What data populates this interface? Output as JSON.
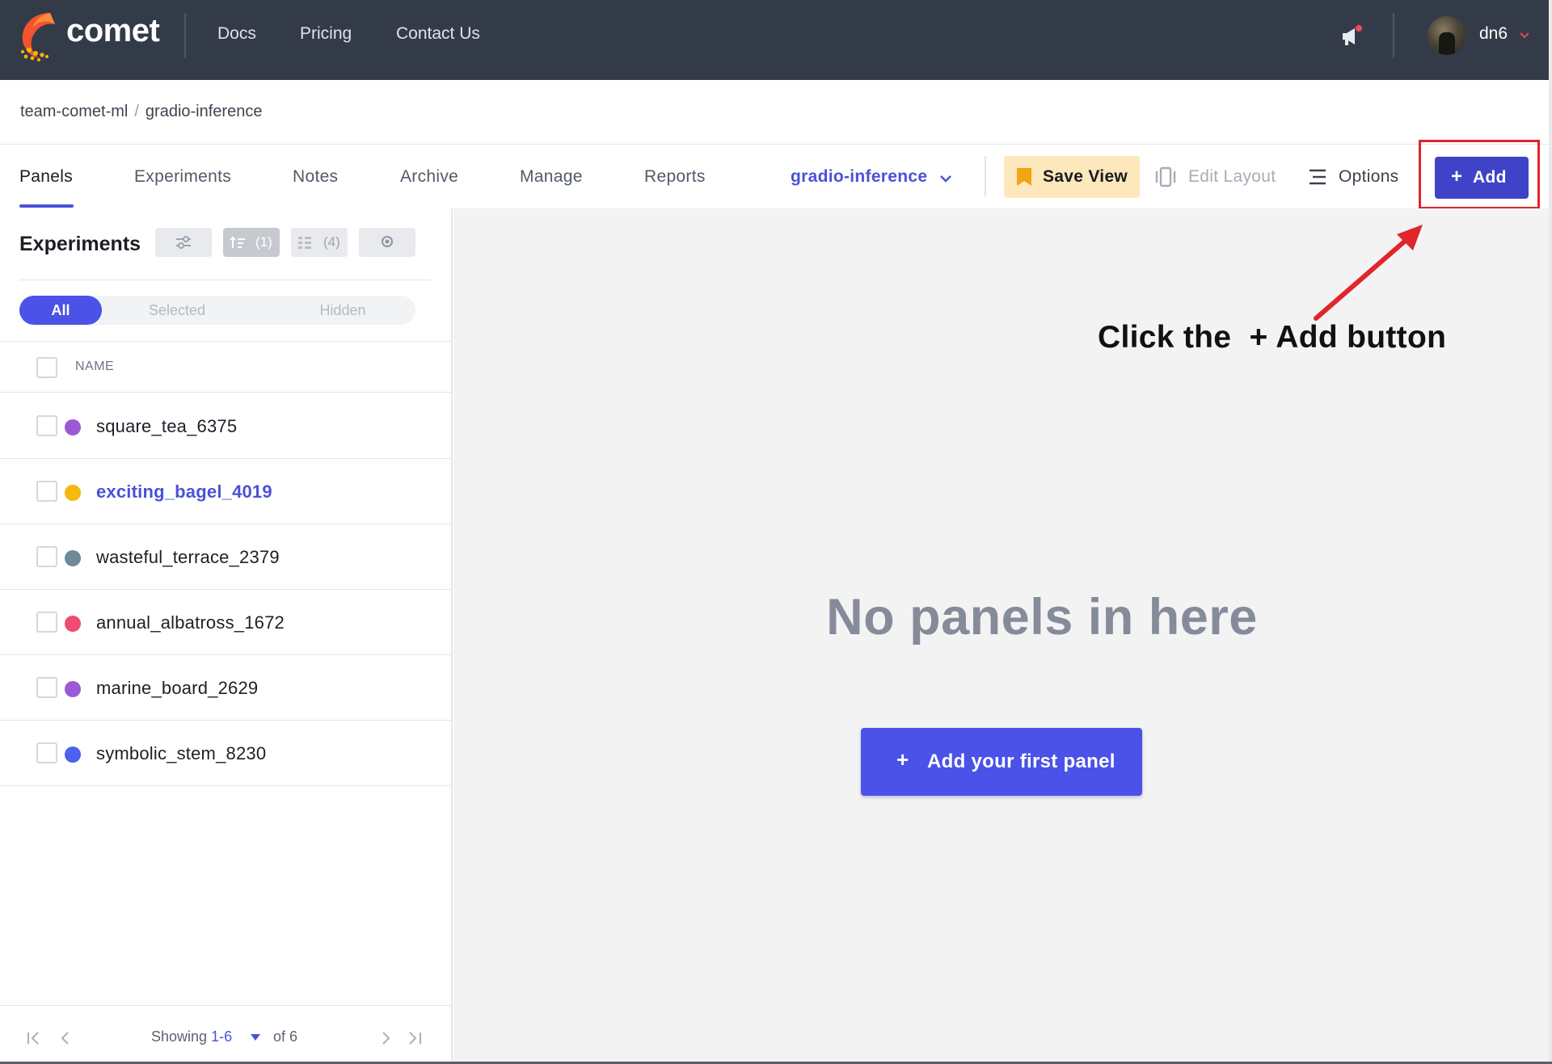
{
  "brand": {
    "name": "comet"
  },
  "nav": {
    "links": [
      "Docs",
      "Pricing",
      "Contact Us"
    ]
  },
  "user": {
    "name": "dn6"
  },
  "breadcrumb": {
    "workspace": "team-comet-ml",
    "separator": "/",
    "project": "gradio-inference"
  },
  "tabs": {
    "items": [
      "Panels",
      "Experiments",
      "Notes",
      "Archive",
      "Manage",
      "Reports"
    ],
    "active": "Panels"
  },
  "view_selector": {
    "value": "gradio-inference"
  },
  "toolbar": {
    "save_view": "Save View",
    "edit_layout": "Edit Layout",
    "options": "Options",
    "add": "Add",
    "add_plus": "+"
  },
  "sidebar": {
    "title": "Experiments",
    "tools": {
      "sort_count": "(1)",
      "group_count": "(4)"
    },
    "segments": [
      "All",
      "Selected",
      "Hidden"
    ],
    "active_segment": "All",
    "column_header": "NAME",
    "experiments": [
      {
        "name": "square_tea_6375",
        "color": "#9b59d4",
        "highlighted": false
      },
      {
        "name": "exciting_bagel_4019",
        "color": "#f5b80f",
        "highlighted": true
      },
      {
        "name": "wasteful_terrace_2379",
        "color": "#6f8a96",
        "highlighted": false
      },
      {
        "name": "annual_albatross_1672",
        "color": "#ee4d73",
        "highlighted": false
      },
      {
        "name": "marine_board_2629",
        "color": "#9b59d4",
        "highlighted": false
      },
      {
        "name": "symbolic_stem_8230",
        "color": "#4a62ee",
        "highlighted": false
      }
    ],
    "pagination": {
      "label": "Showing",
      "range": "1-6",
      "total": "of 6"
    }
  },
  "main": {
    "empty_title": "No panels in here",
    "first_panel_button": "Add your first panel",
    "first_panel_plus": "+"
  },
  "annotation": {
    "text": "Click the  + Add button",
    "color": "#e0252b"
  },
  "colors": {
    "accent": "#4a52e8",
    "navbar": "#343b48",
    "save_view_bg": "#fde7bd"
  }
}
